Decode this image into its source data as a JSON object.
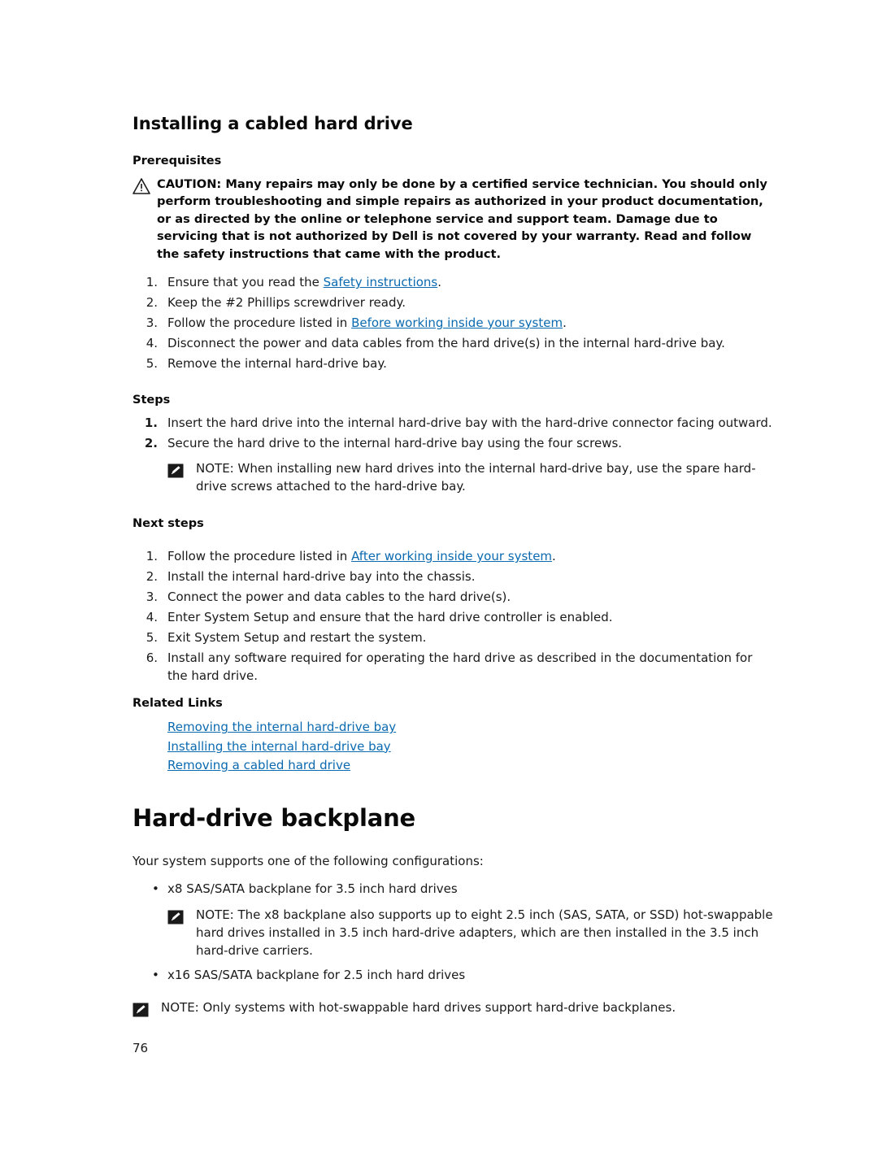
{
  "document": {
    "section_title": "Installing a cabled hard drive",
    "chapter_title": "Hard-drive backplane",
    "page_number": "76"
  },
  "prerequisites": {
    "heading": "Prerequisites",
    "caution_icon": "caution-triangle-icon",
    "caution_text": "CAUTION: Many repairs may only be done by a certified service technician. You should only perform troubleshooting and simple repairs as authorized in your product documentation, or as directed by the online or telephone service and support team. Damage due to servicing that is not authorized by Dell is not covered by your warranty. Read and follow the safety instructions that came with the product.",
    "items": [
      {
        "num": "1.",
        "pre": "Ensure that you read the ",
        "link": "Safety instructions",
        "post": "."
      },
      {
        "num": "2.",
        "pre": "Keep the #2 Phillips screwdriver ready.",
        "link": "",
        "post": ""
      },
      {
        "num": "3.",
        "pre": "Follow the procedure listed in ",
        "link": "Before working inside your system",
        "post": "."
      },
      {
        "num": "4.",
        "pre": "Disconnect the power and data cables from the hard drive(s) in the internal hard-drive bay.",
        "link": "",
        "post": ""
      },
      {
        "num": "5.",
        "pre": "Remove the internal hard-drive bay.",
        "link": "",
        "post": ""
      }
    ]
  },
  "steps": {
    "heading": "Steps",
    "items": [
      {
        "num": "1.",
        "text": "Insert the hard drive into the internal hard-drive bay with the hard-drive connector facing outward."
      },
      {
        "num": "2.",
        "text": "Secure the hard drive to the internal hard-drive bay using the four screws."
      }
    ],
    "note_icon": "note-pencil-icon",
    "note_text": "NOTE: When installing new hard drives into the internal hard-drive bay, use the spare hard-drive screws attached to the hard-drive bay."
  },
  "next_steps": {
    "heading": "Next steps",
    "items": [
      {
        "num": "1.",
        "pre": "Follow the procedure listed in ",
        "link": "After working inside your system",
        "post": "."
      },
      {
        "num": "2.",
        "pre": "Install the internal hard-drive bay into the chassis.",
        "link": "",
        "post": ""
      },
      {
        "num": "3.",
        "pre": "Connect the power and data cables to the hard drive(s).",
        "link": "",
        "post": ""
      },
      {
        "num": "4.",
        "pre": "Enter System Setup and ensure that the hard drive controller is enabled.",
        "link": "",
        "post": ""
      },
      {
        "num": "5.",
        "pre": "Exit System Setup and restart the system.",
        "link": "",
        "post": ""
      },
      {
        "num": "6.",
        "pre": "Install any software required for operating the hard drive as described in the documentation for the hard drive.",
        "link": "",
        "post": ""
      }
    ]
  },
  "related_links": {
    "heading": "Related Links",
    "links": [
      "Removing the internal hard-drive bay",
      "Installing the internal hard-drive bay",
      "Removing a cabled hard drive"
    ]
  },
  "backplane": {
    "intro": "Your system supports one of the following configurations:",
    "bullet_1": "x8 SAS/SATA backplane for 3.5 inch hard drives",
    "note_1_icon": "note-pencil-icon",
    "note_1_text": "NOTE: The x8 backplane also supports up to eight 2.5 inch (SAS, SATA, or SSD) hot-swappable hard drives installed in 3.5 inch hard-drive adapters, which are then installed in the 3.5 inch hard-drive carriers.",
    "bullet_2": "x16 SAS/SATA backplane for 2.5 inch hard drives",
    "note_2_icon": "note-pencil-icon",
    "note_2_text": "NOTE: Only systems with hot-swappable hard drives support hard-drive backplanes.",
    "bullet_glyph": "•"
  },
  "colors": {
    "link": "#0b6ab0",
    "text": "#1a1a1a",
    "heading": "#0a0a0a"
  }
}
